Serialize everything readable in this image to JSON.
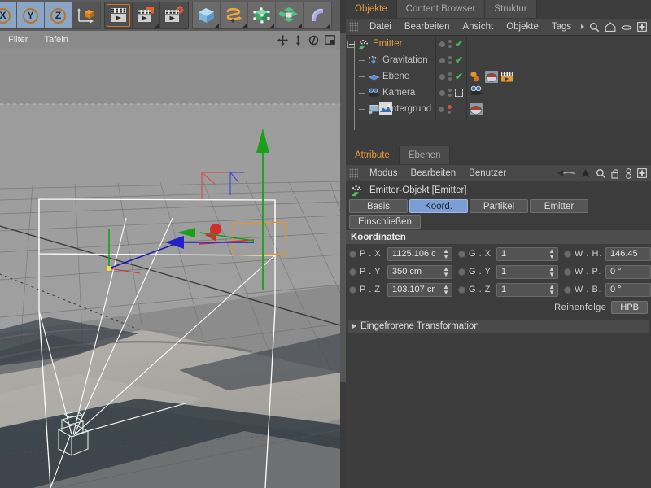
{
  "toolbar": {
    "axis_buttons": [
      {
        "label": "X",
        "name": "axis-x-button",
        "selected": true
      },
      {
        "label": "Y",
        "name": "axis-y-button",
        "selected": true
      },
      {
        "label": "Z",
        "name": "axis-z-button",
        "selected": true
      }
    ],
    "object_axis_label": "object-axis-icon",
    "animation_icons": [
      "play-animation-icon",
      "record-keyframe-icon",
      "autokey-settings-icon"
    ],
    "mode_icons": [
      "cube-icon",
      "twist-deformer-icon",
      "points-mode-icon",
      "polygon-cluster-icon",
      "bend-deformer-icon"
    ]
  },
  "filterbar": {
    "filter_label": "Filter",
    "panels_label": "Tafeln",
    "right_icons": [
      "move-icon",
      "scale-icon",
      "rotate-icon",
      "layout-icon"
    ]
  },
  "viewport": {
    "name": "perspective-viewport",
    "background_sky": "#9e9e9e",
    "ground": "#8a8a8a",
    "gizmo_colors": {
      "x": "#2b2bd4",
      "y": "#18a018",
      "z": "#d42b2b"
    },
    "selection_box_color": "#ffffff",
    "emitter_box_color": "#e0952f"
  },
  "object_manager": {
    "tabs": [
      {
        "label": "Objekte",
        "active": true
      },
      {
        "label": "Content Browser",
        "active": false
      },
      {
        "label": "Struktur",
        "active": false
      }
    ],
    "menu": [
      "Datei",
      "Bearbeiten",
      "Ansicht",
      "Objekte",
      "Tags"
    ],
    "menu_overflow": "chevron-right-icon",
    "menu_icons": [
      "search-icon",
      "home-icon",
      "eye-icon",
      "plus-box-icon"
    ],
    "objects": [
      {
        "label": "Emitter",
        "icon": "emitter-icon",
        "selected": true,
        "expandable": true,
        "indent": 0,
        "visdot": true,
        "state": "check",
        "tags": []
      },
      {
        "label": "Gravitation",
        "icon": "gravitation-icon",
        "selected": false,
        "expandable": false,
        "indent": 1,
        "visdot": true,
        "state": "check",
        "tags": []
      },
      {
        "label": "Ebene",
        "icon": "plane-icon",
        "selected": false,
        "expandable": false,
        "indent": 1,
        "visdot": true,
        "state": "check",
        "tags": [
          "material-tag",
          "texture-tag",
          "animation-tag"
        ]
      },
      {
        "label": "Kamera",
        "icon": "camera-icon",
        "selected": false,
        "expandable": false,
        "indent": 1,
        "visdot": true,
        "state": "dash",
        "tags": [
          "camera-tag",
          "protection-tag"
        ]
      },
      {
        "label": "Hintergrund",
        "icon": "background-icon",
        "selected": false,
        "expandable": false,
        "indent": 1,
        "visdot": true,
        "state": "red",
        "tags": [
          "texture-tag"
        ]
      }
    ]
  },
  "attribute_manager": {
    "tabs": [
      {
        "label": "Attribute",
        "active": true
      },
      {
        "label": "Ebenen",
        "active": false
      }
    ],
    "menu": [
      "Modus",
      "Bearbeiten",
      "Benutzer"
    ],
    "menu_icons": [
      "back-arrow-icon",
      "forward-arrow-icon",
      "up-arrow-icon",
      "search-icon",
      "lock-open-icon",
      "link-icon",
      "plus-box-icon"
    ],
    "object_title": "Emitter-Objekt [Emitter]",
    "object_icon": "emitter-icon",
    "page_tabs": [
      {
        "label": "Basis",
        "active": false
      },
      {
        "label": "Koord.",
        "active": true
      },
      {
        "label": "Partikel",
        "active": false
      },
      {
        "label": "Emitter",
        "active": false
      },
      {
        "label": "Einschließen",
        "active": false
      }
    ],
    "coordinates": {
      "section_title": "Koordinaten",
      "rows": [
        {
          "p_label": "P . X",
          "p_value": "1125.106 c",
          "g_label": "G . X",
          "g_value": "1",
          "w_label": "W . H",
          "w_value": "146.45"
        },
        {
          "p_label": "P . Y",
          "p_value": "350 cm",
          "g_label": "G . Y",
          "g_value": "1",
          "w_label": "W . P",
          "w_value": "0 °"
        },
        {
          "p_label": "P . Z",
          "p_value": "103.107 cr",
          "g_label": "G . Z",
          "g_value": "1",
          "w_label": "W . B",
          "w_value": "0 °"
        }
      ],
      "order_label": "Reihenfolge",
      "order_value": "HPB"
    },
    "frozen_transform_label": "Eingefrorene Transformation"
  }
}
